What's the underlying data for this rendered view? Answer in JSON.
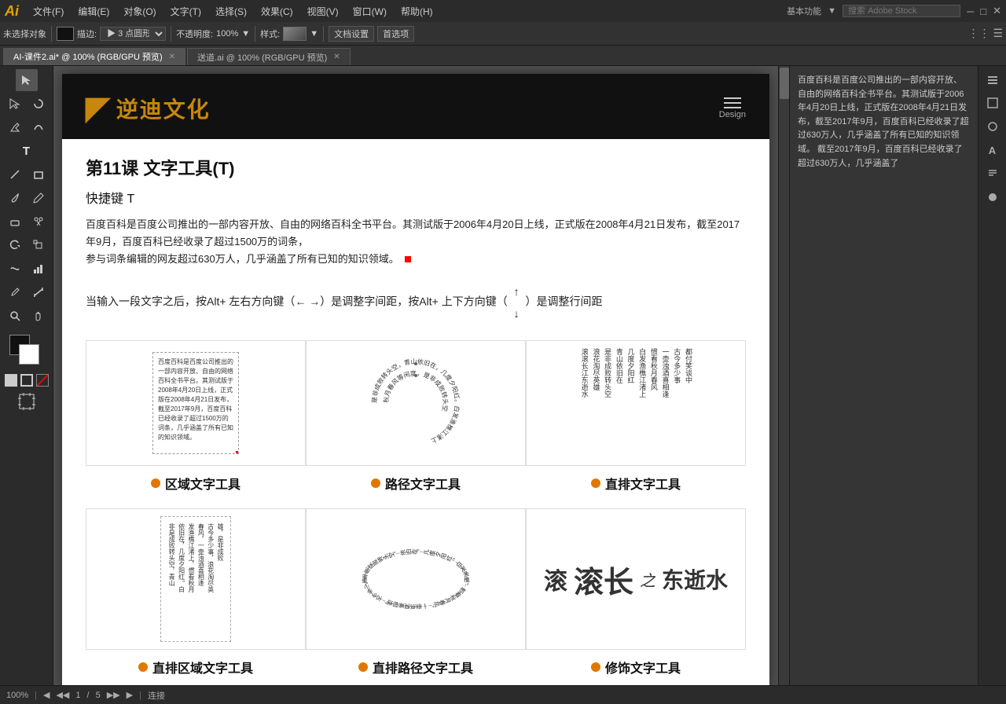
{
  "app": {
    "logo": "Ai",
    "menus": [
      "文件(F)",
      "编辑(E)",
      "对象(O)",
      "文字(T)",
      "选择(S)",
      "效果(C)",
      "视图(V)",
      "窗口(W)",
      "帮助(H)"
    ],
    "workspace": "基本功能",
    "search_placeholder": "搜索 Adobe Stock",
    "toolbar_items": [
      "未选择对象",
      "描边:",
      "▶ 3 点圆形 ▼",
      "不透明度: 100%",
      "样式:",
      "文档设置",
      "首选项"
    ]
  },
  "tabs": [
    {
      "label": "AI-课件2.ai* @ 100% (RGB/GPU 预览)",
      "active": true
    },
    {
      "label": "送道.ai @ 100% (RGB/GPU 预览)",
      "active": false
    }
  ],
  "document": {
    "header": {
      "logo_icon": "D",
      "logo_text": "逆迪文化",
      "menu_label": "Design"
    },
    "lesson_title": "第11课   文字工具(T)",
    "shortcut": "快捷键 T",
    "description": "百度百科是百度公司推出的一部内容开放、自由的网络百科全书平台。其测试版于2006年4月20日上线，正式版在2008年4月21日发布，截至2017年9月，百度百科已经收录了超过1500万的词条，\n参与词条编辑的网友超过630万人，几乎涵盖了所有已知的知识领域。",
    "instruction": "当输入一段文字之后，按Alt+ 左右方向键（← →）是调整字间距，按Alt+ 上下方向键（  ）是调整行间距",
    "examples": [
      {
        "label": "区域文字工具",
        "type": "area"
      },
      {
        "label": "路径文字工具",
        "type": "path"
      },
      {
        "label": "直排文字工具",
        "type": "vertical"
      }
    ],
    "bottom_examples": [
      {
        "label": "直排区域文字工具",
        "type": "vertical-area"
      },
      {
        "label": "直排路径文字工具",
        "type": "vertical-path"
      },
      {
        "label": "修饰文字工具",
        "type": "decoration"
      }
    ]
  },
  "right_panel": {
    "text": "百度百科是百度公司推出的一部内容开放、自由的网络百科全书平台。其测试版于2006年4月20日上线，正式版在2008年4月21日发布，截至2017年9月，百度百科已经收录了超过630万人，几乎涵盖了所有已知的知识领域。\n截至2017年9月，百度百科已经收录了超过630万人，几乎涵盖了"
  },
  "status_bar": {
    "zoom": "100%",
    "page_info": "1/5",
    "tool_info": "连接"
  }
}
